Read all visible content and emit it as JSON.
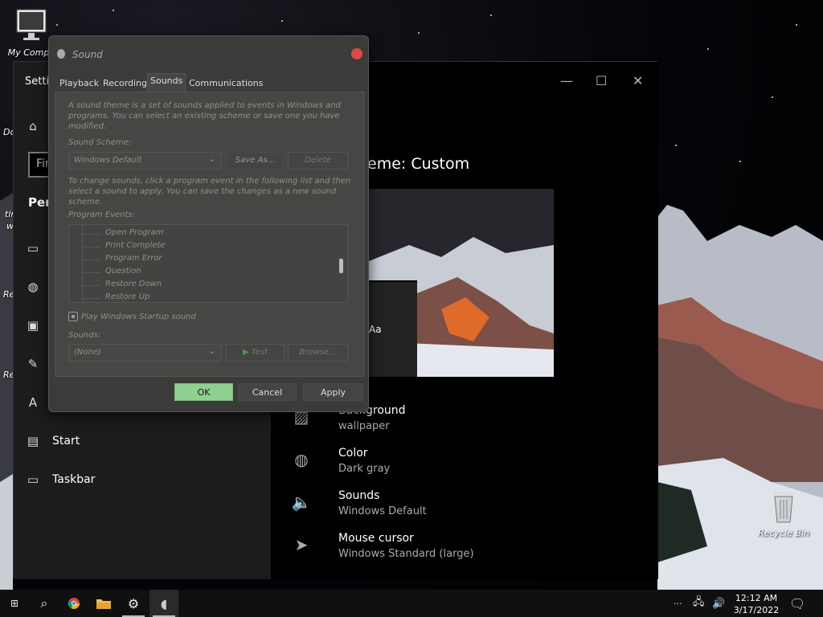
{
  "desktop": {
    "icons": [
      {
        "label": "My Compu"
      },
      {
        "label": "Recycle Bin"
      }
    ],
    "left_edge_fragments": [
      "Do",
      "tir",
      "wi",
      "Re",
      "Re"
    ]
  },
  "settings": {
    "title": "Setti",
    "search_placeholder": "Fir",
    "section_label": "Pers",
    "nav_items": [
      {
        "label": "",
        "icon": "image-icon"
      },
      {
        "label": "",
        "icon": "palette-icon"
      },
      {
        "label": "",
        "icon": "lock-screen-icon"
      },
      {
        "label": "",
        "icon": "themes-icon"
      },
      {
        "label": "",
        "icon": "fonts-icon"
      },
      {
        "label": "Start",
        "icon": "start-icon"
      },
      {
        "label": "Taskbar",
        "icon": "taskbar-icon"
      }
    ],
    "theme_title": "eme: Custom",
    "preview_text": "Aa",
    "theme_items": [
      {
        "name": "Background",
        "value": "wallpaper",
        "icon": "image-icon"
      },
      {
        "name": "Color",
        "value": "Dark gray",
        "icon": "palette-icon"
      },
      {
        "name": "Sounds",
        "value": "Windows Default",
        "icon": "speaker-icon"
      },
      {
        "name": "Mouse cursor",
        "value": "Windows Standard (large)",
        "icon": "cursor-icon"
      }
    ],
    "window_controls": {
      "minimize": "—",
      "maximize": "☐",
      "close": "✕"
    }
  },
  "sound_dialog": {
    "title": "Sound",
    "tabs": [
      "Playback",
      "Recording",
      "Sounds",
      "Communications"
    ],
    "active_tab": "Sounds",
    "intro_text": "A sound theme is a set of sounds applied to events in Windows and programs.  You can select an existing scheme or save one you have modified.",
    "scheme_label": "Sound Scheme:",
    "scheme_value": "Windows Default",
    "save_as_label": "Save As...",
    "delete_label": "Delete",
    "change_text": "To change sounds, click a program event in the following list and then select a sound to apply.  You can save the changes as a new sound scheme.",
    "events_label": "Program Events:",
    "events": [
      "Open Program",
      "Print Complete",
      "Program Error",
      "Question",
      "Restore Down",
      "Restore Up"
    ],
    "startup_label": "Play Windows Startup sound",
    "sounds_label": "Sounds:",
    "sound_value": "(None)",
    "test_label": "Test",
    "browse_label": "Browse...",
    "ok_label": "OK",
    "cancel_label": "Cancel",
    "apply_label": "Apply"
  },
  "taskbar": {
    "time": "12:12 AM",
    "date": "3/17/2022",
    "overflow": "···"
  }
}
